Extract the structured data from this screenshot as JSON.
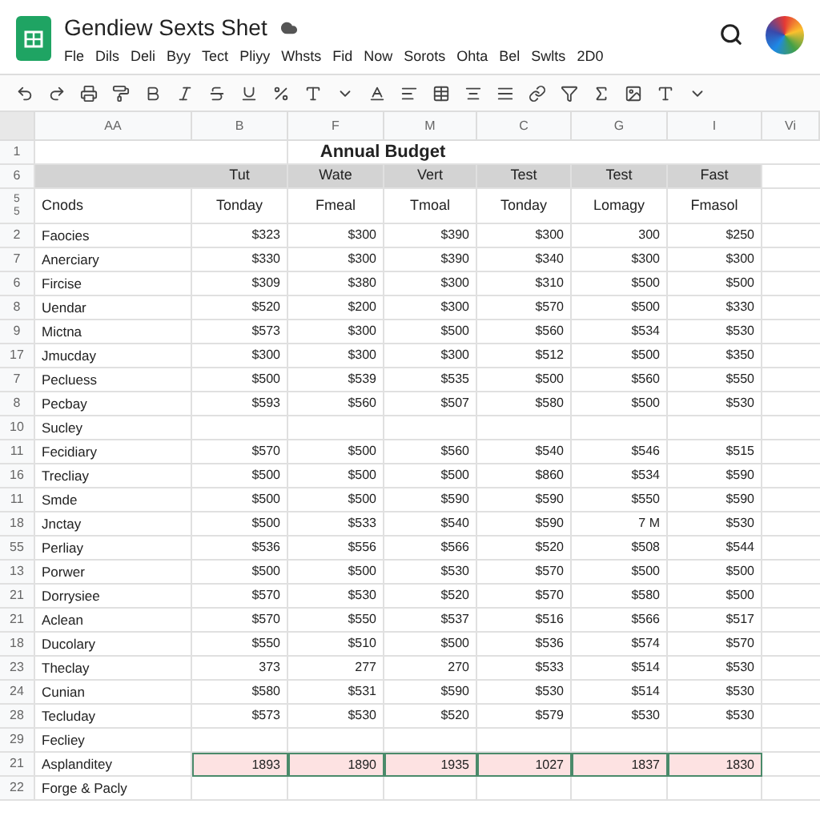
{
  "title": "Gendiew Sexts Shet",
  "menu": [
    "Fle",
    "Dils",
    "Deli",
    "Byy",
    "Tect",
    "Pliyy",
    "Whsts",
    "Fid",
    "Now",
    "Sorots",
    "Ohta",
    "Bel",
    "Swlts",
    "2D0"
  ],
  "columns": [
    "AA",
    "B",
    "F",
    "M",
    "C",
    "G",
    "I",
    "Vi"
  ],
  "title_row": {
    "num": "1",
    "text": "Annual Budget"
  },
  "group_row": {
    "num": "6",
    "cells": [
      "Tut",
      "Wate",
      "Vert",
      "Test",
      "Test",
      "Fast"
    ]
  },
  "head_row": {
    "nums": [
      "5",
      "5"
    ],
    "label": "Cnods",
    "cells": [
      "Tonday",
      "Fmeal",
      "Tmoal",
      "Tonday",
      "Lomagy",
      "Fmasol"
    ]
  },
  "rows": [
    {
      "num": "2",
      "label": "Faocies",
      "kind": "data",
      "values": [
        "$323",
        "$300",
        "$390",
        "$300",
        "300",
        "$250"
      ]
    },
    {
      "num": "7",
      "label": "Anerciary",
      "kind": "data",
      "values": [
        "$330",
        "$300",
        "$390",
        "$340",
        "$300",
        "$300"
      ]
    },
    {
      "num": "6",
      "label": "Fircise",
      "kind": "data",
      "values": [
        "$309",
        "$380",
        "$300",
        "$310",
        "$500",
        "$500"
      ]
    },
    {
      "num": "8",
      "label": "Uendar",
      "kind": "data",
      "values": [
        "$520",
        "$200",
        "$300",
        "$570",
        "$500",
        "$330"
      ]
    },
    {
      "num": "9",
      "label": "Mictna",
      "kind": "data",
      "values": [
        "$573",
        "$300",
        "$500",
        "$560",
        "$534",
        "$530"
      ]
    },
    {
      "num": "17",
      "label": "Jmucday",
      "kind": "data",
      "values": [
        "$300",
        "$300",
        "$300",
        "$512",
        "$500",
        "$350"
      ]
    },
    {
      "num": "7",
      "label": "Pecluess",
      "kind": "data",
      "values": [
        "$500",
        "$539",
        "$535",
        "$500",
        "$560",
        "$550"
      ]
    },
    {
      "num": "8",
      "label": "Pecbay",
      "kind": "data",
      "values": [
        "$593",
        "$560",
        "$507",
        "$580",
        "$500",
        "$530"
      ]
    },
    {
      "num": "10",
      "label": "Sucley",
      "kind": "data"
    },
    {
      "num": "11",
      "label": "Fecidiary",
      "kind": "data",
      "values": [
        "$570",
        "$500",
        "$560",
        "$540",
        "$546",
        "$515"
      ]
    },
    {
      "num": "16",
      "label": "Trecliay",
      "kind": "data",
      "values": [
        "$500",
        "$500",
        "$500",
        "$860",
        "$534",
        "$590"
      ]
    },
    {
      "num": "11",
      "label": "Smde",
      "kind": "data",
      "values": [
        "$500",
        "$500",
        "$590",
        "$590",
        "$550",
        "$590"
      ]
    },
    {
      "num": "18",
      "label": "Jnctay",
      "kind": "data",
      "values": [
        "$500",
        "$533",
        "$540",
        "$590",
        "7 M",
        "$530"
      ]
    },
    {
      "num": "55",
      "label": "Perliay",
      "kind": "data",
      "values": [
        "$536",
        "$556",
        "$566",
        "$520",
        "$508",
        "$544"
      ]
    },
    {
      "num": "13",
      "label": "Porwer",
      "kind": "data",
      "values": [
        "$500",
        "$500",
        "$530",
        "$570",
        "$500",
        "$500"
      ]
    },
    {
      "num": "21",
      "label": "Dorrysiee",
      "kind": "data",
      "values": [
        "$570",
        "$530",
        "$520",
        "$570",
        "$580",
        "$500"
      ]
    },
    {
      "num": "21",
      "label": "Aclean",
      "kind": "data",
      "values": [
        "$570",
        "$550",
        "$537",
        "$516",
        "$566",
        "$517"
      ]
    },
    {
      "num": "18",
      "label": "Ducolary",
      "kind": "data",
      "values": [
        "$550",
        "$510",
        "$500",
        "$536",
        "$574",
        "$570"
      ]
    },
    {
      "num": "23",
      "label": "Theclay",
      "kind": "data",
      "values": [
        "373",
        "277",
        "270",
        "$533",
        "$514",
        "$530"
      ]
    },
    {
      "num": "24",
      "label": "Cunian",
      "kind": "data",
      "values": [
        "$580",
        "$531",
        "$590",
        "$530",
        "$514",
        "$530"
      ]
    },
    {
      "num": "28",
      "label": "Tecluday",
      "kind": "data",
      "values": [
        "$573",
        "$530",
        "$520",
        "$579",
        "$530",
        "$530"
      ]
    },
    {
      "num": "29",
      "label": "Fecliey",
      "kind": "data"
    },
    {
      "num": "21",
      "label": "Asplanditey",
      "kind": "total",
      "values": [
        "1893",
        "1890",
        "1935",
        "1027",
        "1837",
        "1830"
      ]
    },
    {
      "num": "22",
      "label": "Forge & Pacly",
      "kind": "data"
    }
  ]
}
